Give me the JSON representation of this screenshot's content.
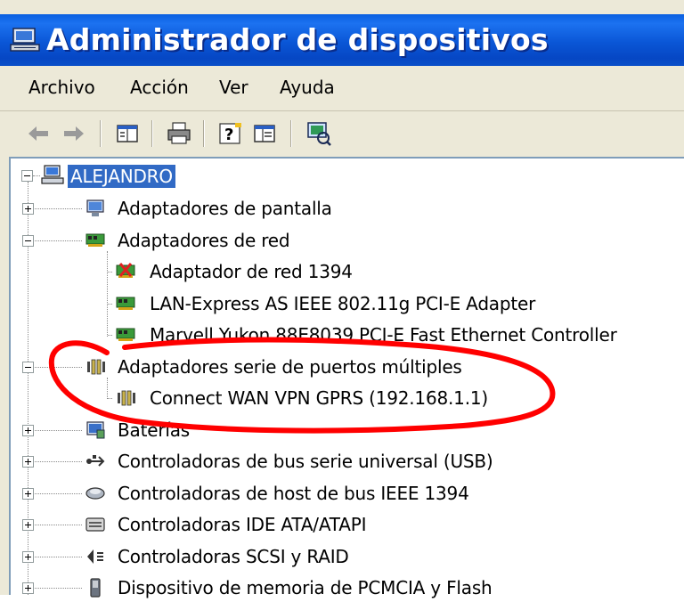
{
  "window": {
    "title": "Administrador de dispositivos"
  },
  "menu": [
    "Archivo",
    "Acción",
    "Ver",
    "Ayuda"
  ],
  "toolbar": {
    "buttons": [
      "back-arrow-icon",
      "forward-arrow-icon",
      "properties-icon",
      "print-icon",
      "help-icon",
      "view-icon",
      "scan-hardware-icon"
    ]
  },
  "tree": {
    "root": "ALEJANDRO",
    "items": [
      {
        "label": "Adaptadores de pantalla",
        "icon": "display-adapter-icon",
        "expander": "plus"
      },
      {
        "label": "Adaptadores de red",
        "icon": "network-adapter-icon",
        "expander": "minus"
      },
      {
        "label": "Adaptador de red 1394",
        "icon": "network-card-disabled-icon",
        "expander": "none"
      },
      {
        "label": "LAN-Express AS IEEE 802.11g PCI-E Adapter",
        "icon": "network-card-icon",
        "expander": "none"
      },
      {
        "label": "Marvell Yukon 88E8039 PCI-E Fast Ethernet Controller",
        "icon": "network-card-icon",
        "expander": "none"
      },
      {
        "label": "Adaptadores serie de puertos múltiples",
        "icon": "multiport-serial-icon",
        "expander": "minus"
      },
      {
        "label": "Connect WAN VPN GPRS (192.168.1.1)",
        "icon": "multiport-serial-icon",
        "expander": "none"
      },
      {
        "label": "Baterías",
        "icon": "battery-icon",
        "expander": "plus"
      },
      {
        "label": "Controladoras de bus serie universal (USB)",
        "icon": "usb-icon",
        "expander": "plus"
      },
      {
        "label": "Controladoras de host de bus IEEE 1394",
        "icon": "ieee1394-icon",
        "expander": "plus"
      },
      {
        "label": "Controladoras IDE ATA/ATAPI",
        "icon": "ide-controller-icon",
        "expander": "plus"
      },
      {
        "label": "Controladoras SCSI y RAID",
        "icon": "scsi-controller-icon",
        "expander": "plus"
      },
      {
        "label": "Dispositivo de memoria de PCMCIA y Flash",
        "icon": "pcmcia-icon",
        "expander": "plus"
      }
    ]
  },
  "colors": {
    "titlebar": "#0a56d6",
    "selection": "#316ac5",
    "annotation": "#ff0000"
  }
}
